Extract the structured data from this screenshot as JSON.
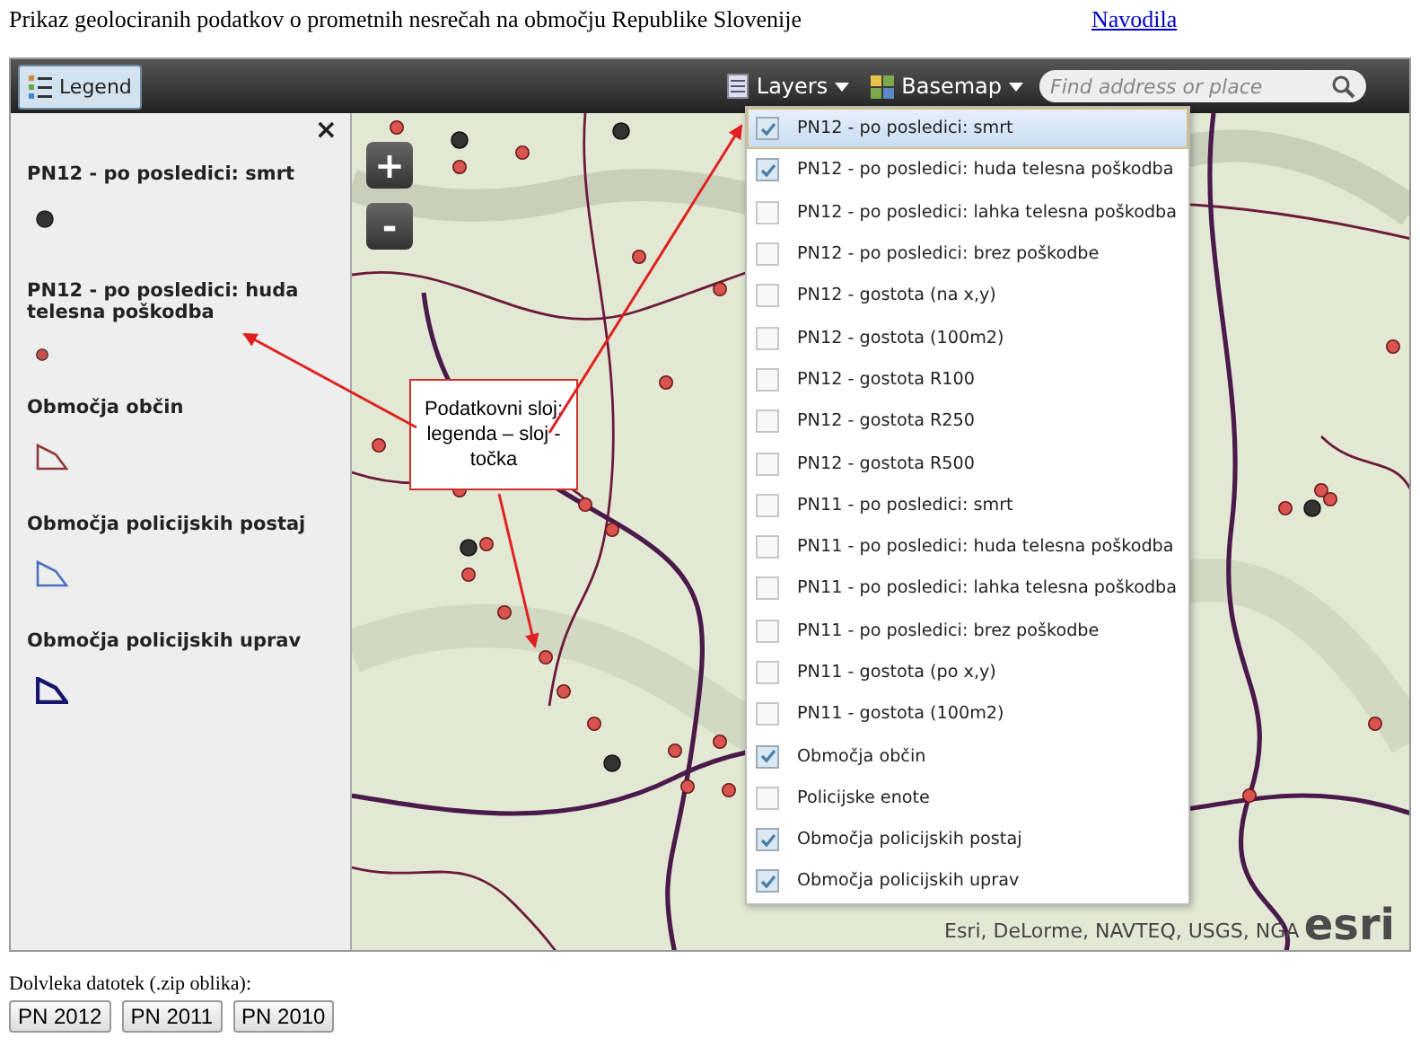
{
  "page": {
    "title": "Prikaz geolociranih podatkov o prometnih nesrečah na območju Republike Slovenije",
    "help_link": "Navodila"
  },
  "toolbar": {
    "legend_button": {
      "label": "Legend",
      "selected": true
    },
    "layers_button": "Layers",
    "basemap_button": "Basemap",
    "search": {
      "placeholder": "Find address or place"
    }
  },
  "legend": {
    "close": "×",
    "items": [
      {
        "label": "PN12 - po posledici: smrt",
        "kind": "point",
        "color": "#333333"
      },
      {
        "label": "PN12 - po posledici: huda telesna poškodba",
        "kind": "point",
        "color": "#c8504c"
      },
      {
        "label": "Območja občin",
        "kind": "polygon",
        "color": "#8b3a3a"
      },
      {
        "label": "Območja policijskih postaj",
        "kind": "polygon",
        "color": "#4a6fbf"
      },
      {
        "label": "Območja policijskih uprav",
        "kind": "polygon",
        "color": "#15156e"
      }
    ]
  },
  "map": {
    "zoom_in": "+",
    "zoom_out": "-",
    "attribution": "Esri, DeLorme, NAVTEQ, USGS, NGA",
    "logo": "esri"
  },
  "layers": [
    {
      "label": "PN12 - po posledici: smrt",
      "checked": true,
      "selected": true
    },
    {
      "label": "PN12 - po posledici: huda telesna poškodba",
      "checked": true,
      "selected": false
    },
    {
      "label": "PN12 - po posledici: lahka telesna poškodba",
      "checked": false,
      "selected": false
    },
    {
      "label": "PN12 - po posledici: brez poškodbe",
      "checked": false,
      "selected": false
    },
    {
      "label": "PN12 - gostota (na x,y)",
      "checked": false,
      "selected": false
    },
    {
      "label": "PN12 - gostota (100m2)",
      "checked": false,
      "selected": false
    },
    {
      "label": "PN12 - gostota R100",
      "checked": false,
      "selected": false
    },
    {
      "label": "PN12 - gostota R250",
      "checked": false,
      "selected": false
    },
    {
      "label": "PN12 - gostota R500",
      "checked": false,
      "selected": false
    },
    {
      "label": "PN11 - po posledici: smrt",
      "checked": false,
      "selected": false
    },
    {
      "label": "PN11 - po posledici: huda telesna poškodba",
      "checked": false,
      "selected": false
    },
    {
      "label": "PN11 - po posledici: lahka telesna poškodba",
      "checked": false,
      "selected": false
    },
    {
      "label": "PN11 - po posledici: brez poškodbe",
      "checked": false,
      "selected": false
    },
    {
      "label": "PN11 - gostota (po x,y)",
      "checked": false,
      "selected": false
    },
    {
      "label": "PN11 - gostota (100m2)",
      "checked": false,
      "selected": false
    },
    {
      "label": "Območja občin",
      "checked": true,
      "selected": false
    },
    {
      "label": "Policijske enote",
      "checked": false,
      "selected": false
    },
    {
      "label": "Območja policijskih postaj",
      "checked": true,
      "selected": false
    },
    {
      "label": "Območja policijskih uprav",
      "checked": true,
      "selected": false
    }
  ],
  "callout": {
    "text": "Podatkovni sloj: legenda – sloj - točka"
  },
  "downloads": {
    "label": "Dolvleka datotek (.zip oblika):",
    "buttons": [
      "PN 2012",
      "PN 2011",
      "PN 2010"
    ]
  }
}
